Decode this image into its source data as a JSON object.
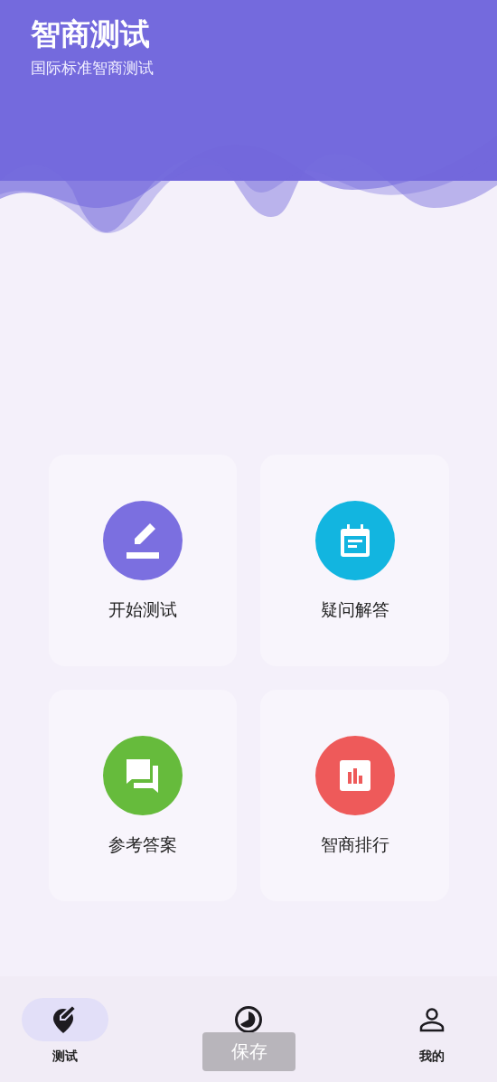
{
  "header": {
    "title": "智商测试",
    "subtitle": "国际标准智商测试"
  },
  "cards": [
    {
      "kind": "edit",
      "label": "开始测试",
      "color": "#7b6fe0"
    },
    {
      "kind": "calendar",
      "label": "疑问解答",
      "color": "#12b5e0"
    },
    {
      "kind": "chat",
      "label": "参考答案",
      "color": "#66bb3c"
    },
    {
      "kind": "chart",
      "label": "智商排行",
      "color": "#ee5a5a"
    }
  ],
  "nav": [
    {
      "kind": "test",
      "label": "测试",
      "selected": true
    },
    {
      "kind": "pie",
      "selected": false
    },
    {
      "kind": "person",
      "label": "我的",
      "selected": false
    }
  ],
  "toast": "保存"
}
